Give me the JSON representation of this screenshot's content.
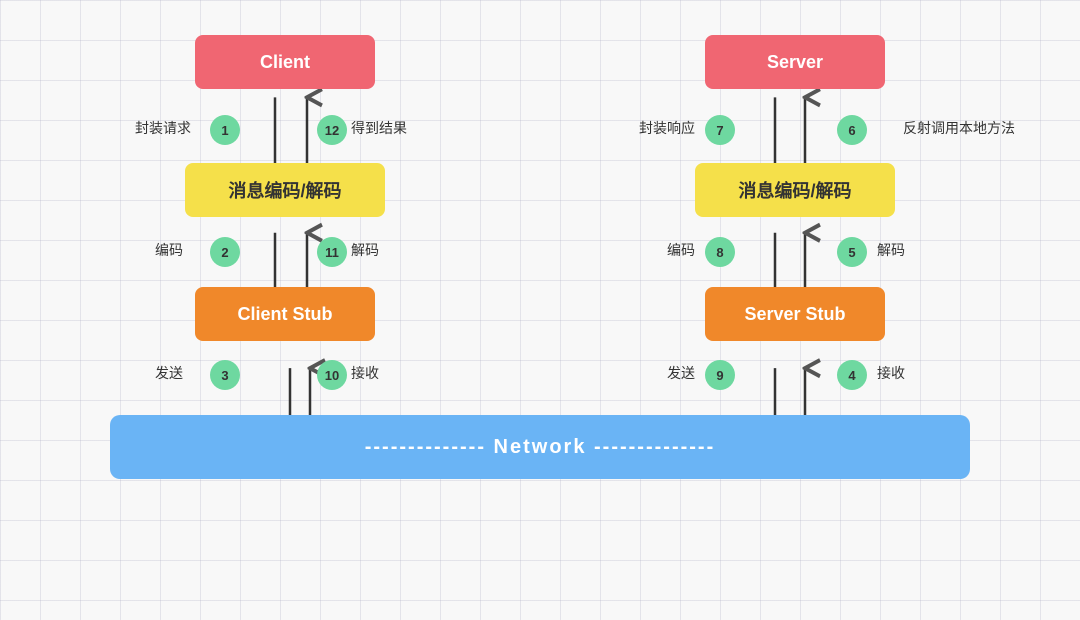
{
  "boxes": {
    "client": "Client",
    "server": "Server",
    "codec_left": "消息编码/解码",
    "codec_right": "消息编码/解码",
    "client_stub": "Client Stub",
    "server_stub": "Server Stub"
  },
  "network": {
    "label": "-------------- Network  --------------"
  },
  "steps": {
    "s1": {
      "num": "1",
      "label": "封装请求"
    },
    "s2": {
      "num": "2",
      "label": "编码"
    },
    "s3": {
      "num": "3",
      "label": "发送"
    },
    "s4": {
      "num": "4",
      "label": "接收"
    },
    "s5": {
      "num": "5",
      "label": "解码"
    },
    "s6": {
      "num": "6",
      "label": "反射调用本地方法"
    },
    "s7": {
      "num": "7",
      "label": "封装响应"
    },
    "s8": {
      "num": "8",
      "label": "编码"
    },
    "s9": {
      "num": "9",
      "label": "发送"
    },
    "s10": {
      "num": "10",
      "label": "接收"
    },
    "s11": {
      "num": "11",
      "label": "解码"
    },
    "s12": {
      "num": "12",
      "label": "得到结果"
    }
  },
  "colors": {
    "red": "#f06672",
    "yellow": "#f5e04a",
    "orange": "#f0882a",
    "blue": "#6ab4f5",
    "green": "#6ed8a0"
  }
}
